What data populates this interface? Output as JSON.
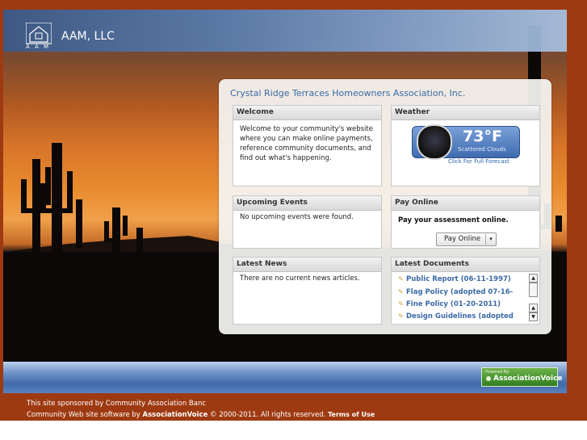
{
  "header": {
    "company": "AAM, LLC",
    "logo_text": "A A M"
  },
  "panel": {
    "title": "Crystal Ridge Terraces Homeowners Association, Inc.",
    "welcome": {
      "title": "Welcome",
      "body": "Welcome to your community's website where you can make online payments, reference community documents, and find out what's happening."
    },
    "weather": {
      "title": "Weather",
      "temp": "73°F",
      "condition": "Scattered Clouds",
      "link": "Click For Full Forecast"
    },
    "events": {
      "title": "Upcoming Events",
      "body": "No upcoming events were found."
    },
    "pay": {
      "title": "Pay Online",
      "text": "Pay your assessment online.",
      "button": "Pay Online",
      "caret": "▾"
    },
    "news": {
      "title": "Latest News",
      "body": "There are no current news articles."
    },
    "docs": {
      "title": "Latest Documents",
      "items": [
        "Public Report (06-11-1997)",
        "Flag Policy (adopted 07-16-",
        "Fine Policy (01-20-2011)",
        "Design Guidelines (adopted"
      ]
    }
  },
  "powered": {
    "small": "Powered By:",
    "brand": "AssociationVoice"
  },
  "footer": {
    "sponsor": "This site sponsored by Community Association Banc",
    "software_prefix": "Community Web site software by ",
    "software_brand": "AssociationVoice",
    "copyright": " © 2000-2011. All rights reserved. ",
    "terms": "Terms of Use"
  }
}
